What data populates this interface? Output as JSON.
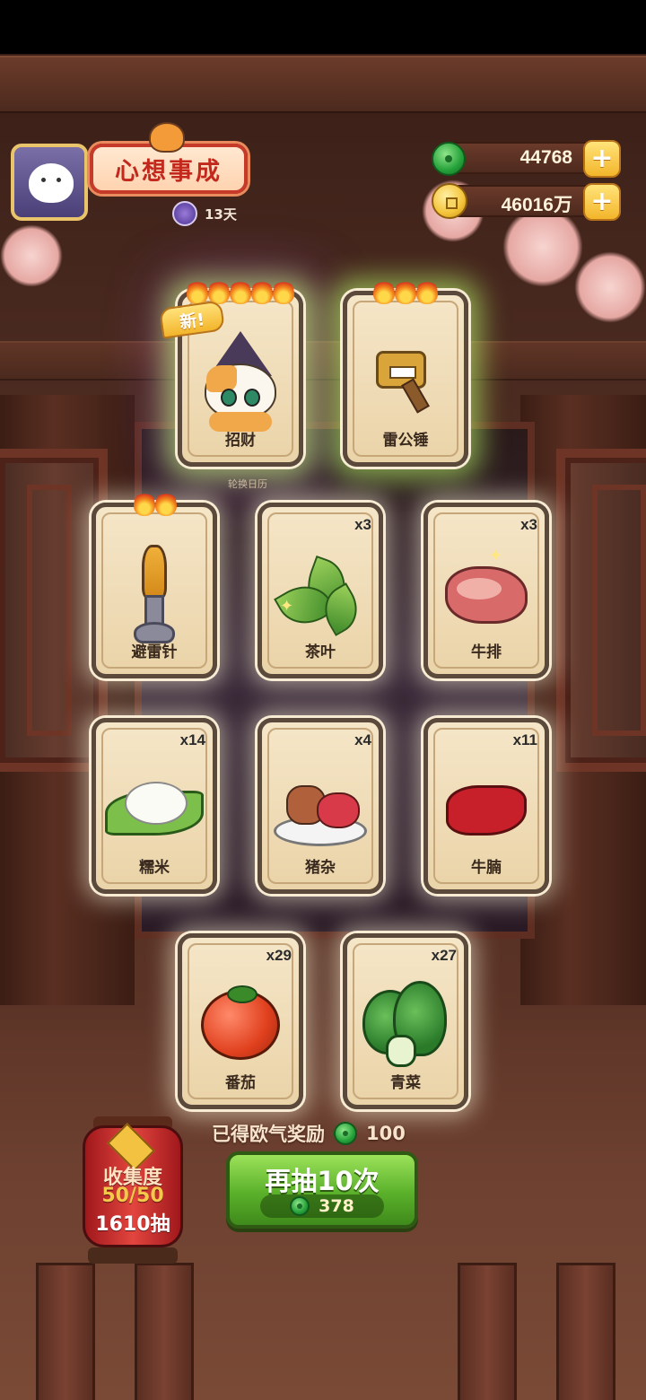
{
  "header": {
    "title_banner": "心想事成",
    "days_label": "13天"
  },
  "currencies": {
    "jade": {
      "amount": "44768",
      "icon": "jade-icon",
      "add_label": "+"
    },
    "coins": {
      "amount": "46016万",
      "icon": "coin-icon",
      "add_label": "+"
    }
  },
  "rotate_hint": "轮换日历",
  "cards": [
    {
      "name": "招财",
      "count": "",
      "flames": 5,
      "is_new": true,
      "new_label": "新!",
      "art": "calico-cat"
    },
    {
      "name": "雷公锤",
      "count": "",
      "flames": 3,
      "is_new": false,
      "art": "thunder-hammer"
    },
    {
      "name": "避雷针",
      "count": "",
      "flames": 2,
      "is_new": false,
      "art": "lightning-rod"
    },
    {
      "name": "茶叶",
      "count": "x3",
      "flames": 0,
      "is_new": false,
      "art": "tea-leaves"
    },
    {
      "name": "牛排",
      "count": "x3",
      "flames": 0,
      "is_new": false,
      "art": "steak"
    },
    {
      "name": "糯米",
      "count": "x14",
      "flames": 0,
      "is_new": false,
      "art": "glutinous-rice"
    },
    {
      "name": "猪杂",
      "count": "x4",
      "flames": 0,
      "is_new": false,
      "art": "pork-offal"
    },
    {
      "name": "牛腩",
      "count": "x11",
      "flames": 0,
      "is_new": false,
      "art": "beef-brisket"
    },
    {
      "name": "番茄",
      "count": "x29",
      "flames": 0,
      "is_new": false,
      "art": "tomato"
    },
    {
      "name": "青菜",
      "count": "x27",
      "flames": 0,
      "is_new": false,
      "art": "bok-choy"
    }
  ],
  "reward": {
    "label": "已得欧气奖励",
    "value": "100"
  },
  "draw_button": {
    "label": "再抽10次",
    "cost": "378"
  },
  "collection": {
    "label": "收集度",
    "progress": "50/50",
    "draws": "1610抽"
  },
  "colors": {
    "accent_green": "#5ab02a",
    "banner_red": "#c2291c",
    "gold": "#f3b52b"
  }
}
